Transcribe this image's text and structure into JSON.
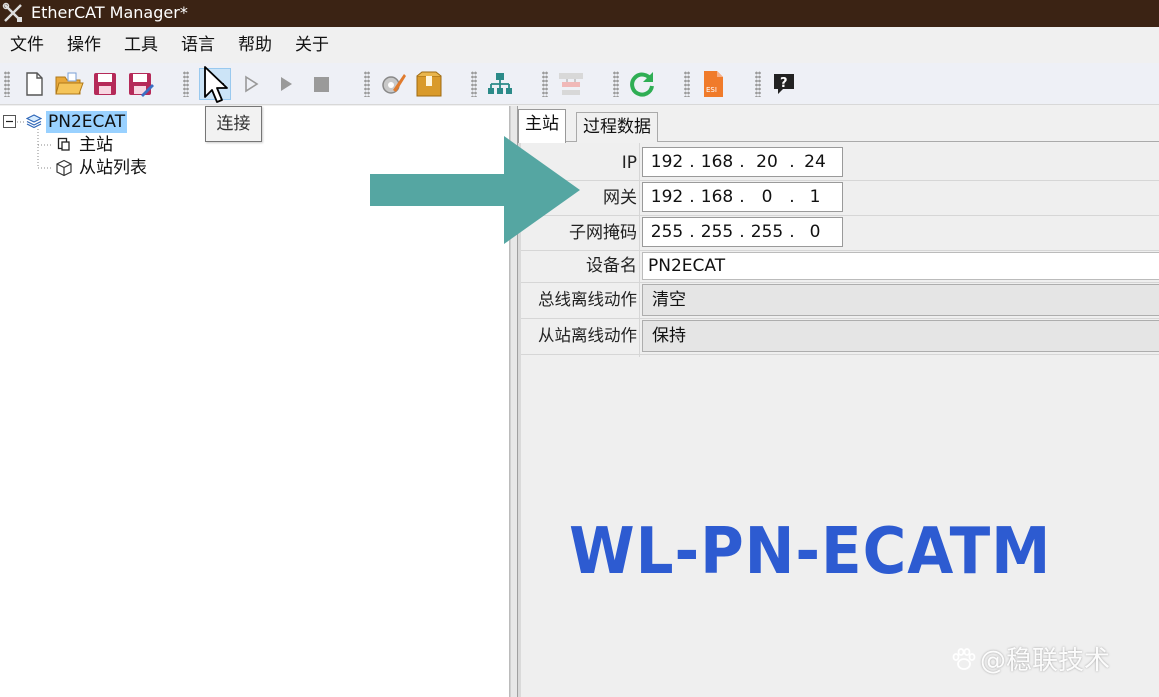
{
  "window": {
    "title": "EtherCAT Manager*"
  },
  "menu": [
    "文件",
    "操作",
    "工具",
    "语言",
    "帮助",
    "关于"
  ],
  "toolbar": {
    "tooltip": "连接",
    "buttons": [
      "new-file-icon",
      "open-folder-icon",
      "save-icon",
      "save-as-icon",
      "connect-icon",
      "step-icon",
      "run-icon",
      "stop-icon",
      "configure-icon",
      "package-icon",
      "network-topology-icon",
      "scan-icon",
      "refresh-icon",
      "esi-icon",
      "help-icon"
    ],
    "esi_label": "ESI",
    "help_glyph": "?"
  },
  "tree": {
    "root": "PN2ECAT",
    "master": "主站",
    "slave_list": "从站列表"
  },
  "tabs": [
    "主站",
    "过程数据"
  ],
  "master_form": {
    "ip_label": "IP",
    "ip": [
      "192",
      "168",
      "20",
      "24"
    ],
    "gateway_label": "网关",
    "gateway": [
      "192",
      "168",
      "0",
      "1"
    ],
    "subnet_label": "子网掩码",
    "subnet": [
      "255",
      "255",
      "255",
      "0"
    ],
    "device_name_label": "设备名",
    "device_name": "PN2ECAT",
    "bus_offline_label": "总线离线动作",
    "bus_offline_value": "清空",
    "slave_offline_label": "从站离线动作",
    "slave_offline_value": "保持"
  },
  "product_name": "WL-PN-ECATM",
  "watermark": "@稳联技术",
  "colors": {
    "titlebar": "#3b2314",
    "selection": "#99d1ff",
    "product_text": "#2d5bd1",
    "arrow": "#55a6a2"
  }
}
